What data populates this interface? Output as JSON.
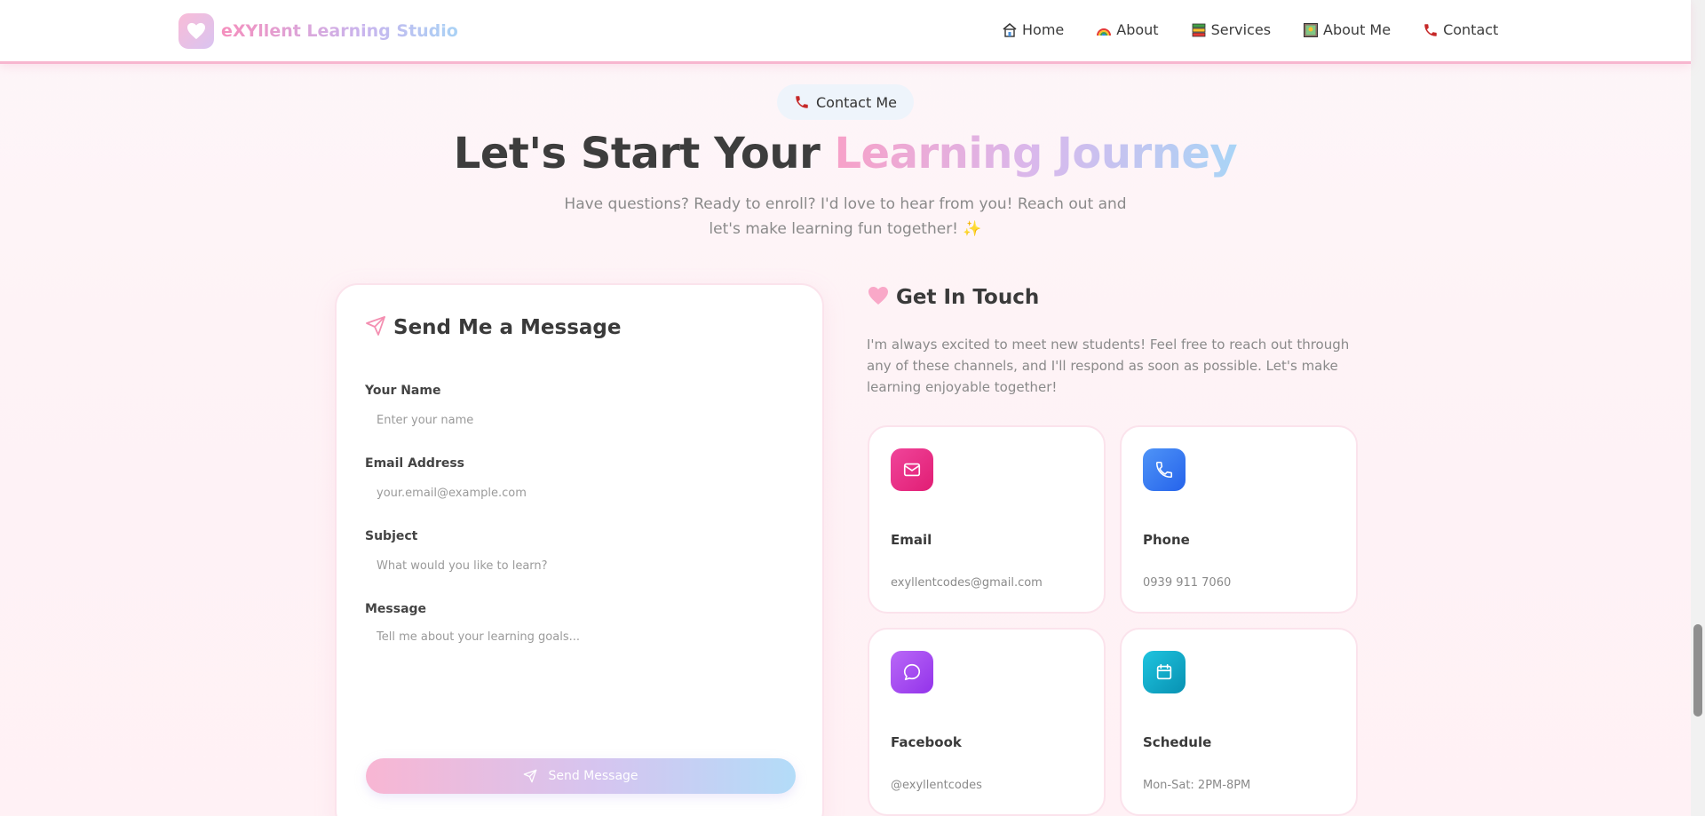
{
  "brand": {
    "name": "eXYllent Learning Studio",
    "logo_icon": "heart-icon"
  },
  "nav": {
    "items": [
      {
        "label": "Home",
        "icon": "house-icon"
      },
      {
        "label": "About",
        "icon": "rainbow-icon"
      },
      {
        "label": "Services",
        "icon": "books-icon"
      },
      {
        "label": "About Me",
        "icon": "picture-icon"
      },
      {
        "label": "Contact",
        "icon": "telephone-icon"
      }
    ]
  },
  "hero": {
    "pill_label": "Contact Me",
    "title_plain": "Let's Start Your ",
    "title_highlight": "Learning Journey",
    "subtitle": "Have questions? Ready to enroll? I'd love to hear from you! Reach out and let's make learning fun together! ✨"
  },
  "form": {
    "heading": "Send Me a Message",
    "name_label": "Your Name",
    "name_placeholder": "Enter your name",
    "email_label": "Email Address",
    "email_placeholder": "your.email@example.com",
    "subject_label": "Subject",
    "subject_placeholder": "What would you like to learn?",
    "message_label": "Message",
    "message_placeholder": "Tell me about your learning goals...",
    "submit_label": "Send Message"
  },
  "touch": {
    "heading": "Get In Touch",
    "description": "I'm always excited to meet new students! Feel free to reach out through any of these channels, and I'll respond as soon as possible. Let's make learning enjoyable together!",
    "cards": [
      {
        "title": "Email",
        "value": "exyllentcodes@gmail.com",
        "icon": "mail-icon",
        "color": "#ec4899"
      },
      {
        "title": "Phone",
        "value": "0939 911 7060",
        "icon": "phone-icon",
        "color": "#3b82f6"
      },
      {
        "title": "Facebook",
        "value": "@exyllentcodes",
        "icon": "chat-bubble-icon",
        "color": "#a855f7"
      },
      {
        "title": "Schedule",
        "value": "Mon-Sat: 2PM-8PM",
        "icon": "calendar-icon",
        "color": "#06b6d4"
      }
    ]
  },
  "colors": {
    "accent_pink": "#f7a1c8",
    "accent_blue": "#a9d4f6",
    "header_border": "#f7b6cf"
  }
}
